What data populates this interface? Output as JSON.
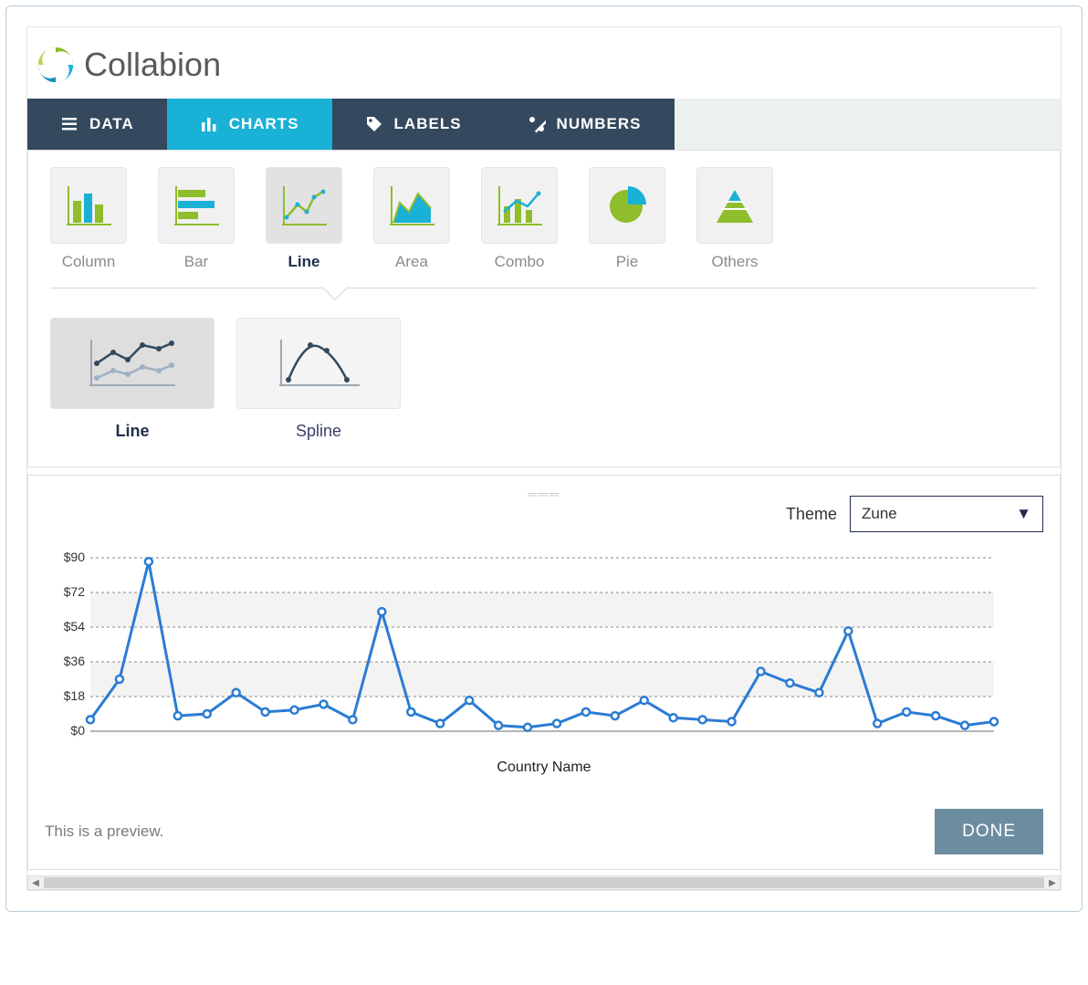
{
  "brand": "Collabion",
  "tabs": [
    "DATA",
    "CHARTS",
    "LABELS",
    "NUMBERS"
  ],
  "active_tab": "CHARTS",
  "chart_types": [
    {
      "label": "Column"
    },
    {
      "label": "Bar"
    },
    {
      "label": "Line"
    },
    {
      "label": "Area"
    },
    {
      "label": "Combo"
    },
    {
      "label": "Pie"
    },
    {
      "label": "Others"
    }
  ],
  "active_type": "Line",
  "subtypes": [
    {
      "label": "Line"
    },
    {
      "label": "Spline"
    }
  ],
  "active_subtype": "Line",
  "theme": {
    "label": "Theme",
    "value": "Zune"
  },
  "preview_note": "This is a preview.",
  "done_label": "DONE",
  "x_axis_label": "Country Name",
  "y_ticks": [
    "$90",
    "$72",
    "$54",
    "$36",
    "$18",
    "$0"
  ],
  "chart_data": {
    "type": "line",
    "title": "",
    "xlabel": "Country Name",
    "ylabel": "",
    "ylim": [
      0,
      90
    ],
    "yticks": [
      0,
      18,
      36,
      54,
      72,
      90
    ],
    "y_prefix": "$",
    "categories": [],
    "values": [
      6,
      27,
      88,
      8,
      9,
      20,
      10,
      11,
      14,
      6,
      62,
      10,
      4,
      16,
      3,
      2,
      4,
      10,
      8,
      16,
      7,
      6,
      5,
      31,
      25,
      20,
      52,
      4,
      10,
      8,
      3,
      5
    ]
  }
}
